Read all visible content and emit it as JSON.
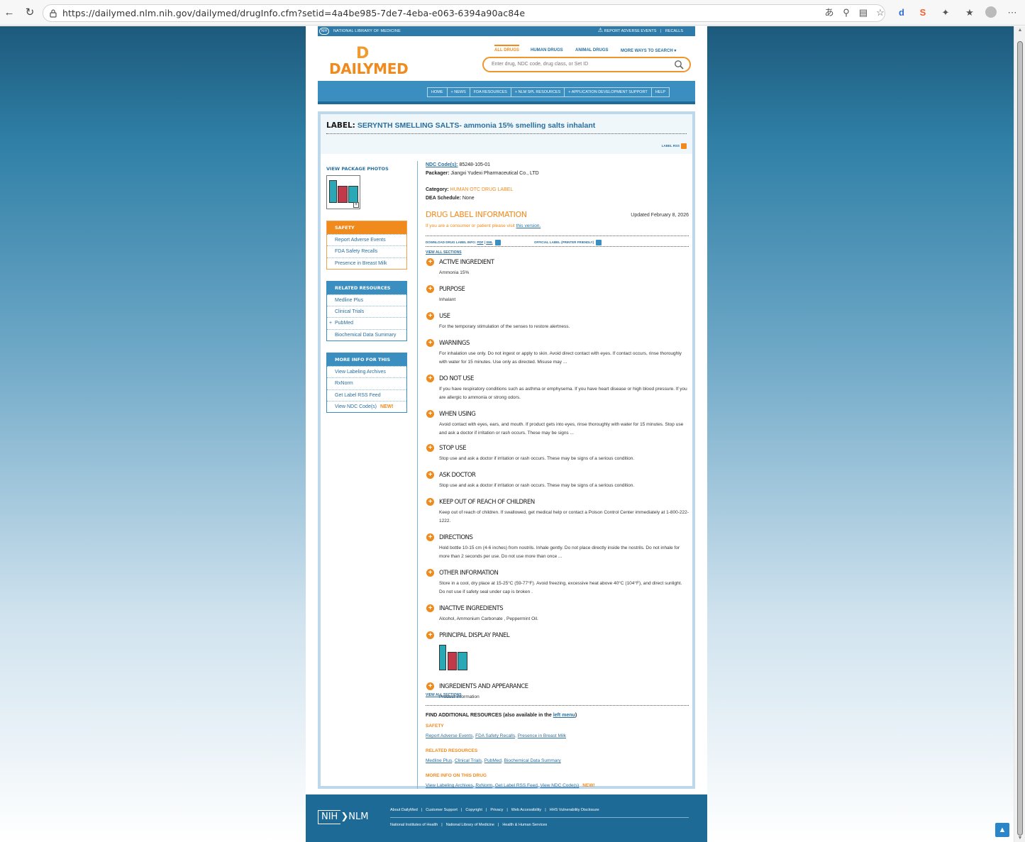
{
  "browser": {
    "url": "https://dailymed.nlm.nih.gov/dailymed/drugInfo.cfm?setid=4a4be985-7de7-4eba-e063-6394a90ac84e"
  },
  "nlm_bar": {
    "label": "NATIONAL LIBRARY OF MEDICINE",
    "nih": "NIH",
    "report": "REPORT ADVERSE EVENTS",
    "recalls": "RECALLS"
  },
  "logo": {
    "mark": "D",
    "word": "DAILYMED"
  },
  "top_tabs": [
    "ALL DRUGS",
    "HUMAN DRUGS",
    "ANIMAL DRUGS",
    "MORE WAYS TO SEARCH ▾"
  ],
  "search": {
    "placeholder": "Enter drug, NDC code, drug class, or Set ID"
  },
  "main_nav": [
    "HOME",
    "+ NEWS",
    "FDA RESOURCES",
    "+ NLM SPL RESOURCES",
    "+ APPLICATION DEVELOPMENT SUPPORT",
    "HELP"
  ],
  "label": {
    "prefix": "LABEL:",
    "name": "SERYNTH SMELLING SALTS- ammonia 15% smelling salts inhalant",
    "rss": "LABEL RSS"
  },
  "sidebar": {
    "view_package_photos": "VIEW PACKAGE PHOTOS",
    "safety": {
      "title": "SAFETY",
      "items": [
        "Report Adverse Events",
        "FDA Safety Recalls",
        "Presence in Breast Milk"
      ]
    },
    "related": {
      "title": "RELATED RESOURCES",
      "items": [
        "Medline Plus",
        "Clinical Trials",
        "PubMed",
        "Biochemical Data Summary"
      ]
    },
    "more": {
      "title": "MORE INFO FOR THIS DRUG",
      "items": [
        "View Labeling Archives",
        "RxNorm",
        "Get Label RSS Feed",
        "View NDC Code(s)"
      ],
      "new_tag": "NEW!"
    }
  },
  "meta": {
    "ndc_label": "NDC Code(s):",
    "ndc_value": "85248-105-01",
    "packager_label": "Packager:",
    "packager_value": "Jiangxi Yudexi Pharmaceutical Co., LTD",
    "category_label": "Category:",
    "category_value": "HUMAN OTC DRUG LABEL",
    "dea_label": "DEA Schedule:",
    "dea_value": "None"
  },
  "drug_label_info": {
    "title": "DRUG LABEL INFORMATION",
    "updated": "Updated February 8, 2026",
    "consumer_text": "If you are a consumer or patient please visit",
    "consumer_link": "this version.",
    "download_label": "DOWNLOAD DRUG LABEL INFO:",
    "pdf": "PDF",
    "xml": "XML",
    "official": "OFFICIAL LABEL (PRINTER FRIENDLY)",
    "view_all": "VIEW ALL SECTIONS"
  },
  "sections": [
    {
      "title": "ACTIVE INGREDIENT",
      "text": "Ammonia 15%"
    },
    {
      "title": "PURPOSE",
      "text": "Inhalant"
    },
    {
      "title": "USE",
      "text": "For the temporary stimulation of the senses to restore alertness."
    },
    {
      "title": "WARNINGS",
      "text": "For inhalation use only. Do not ingest or apply to skin. Avoid direct contact with eyes. If contact occurs, rinse thoroughly with water for 15 minutes. Use only as directed. Misuse may ..."
    },
    {
      "title": "DO NOT USE",
      "text": "If you have respiratory conditions such as asthma or emphysema. If you have heart disease or high blood pressure. If you are allergic to ammonia or strong odors."
    },
    {
      "title": "WHEN USING",
      "text": "Avoid contact with eyes, ears, and mouth. If product gets into eyes, rinse thoroughly with water for 15 minutes. Stop use and ask a doctor if irritation or rash occurs. These may be signs ..."
    },
    {
      "title": "STOP USE",
      "text": "Stop use and ask a doctor if irritation or rash occurs. These may be signs of a serious condition."
    },
    {
      "title": "ASK DOCTOR",
      "text": "Stop use and ask a doctor if irritation or rash occurs. These may be signs of a serious condition."
    },
    {
      "title": "KEEP OUT OF REACH OF CHILDREN",
      "text": "Keep out of reach of children. If swallowed, get medical help or contact a Poison Control Center immediately at 1-800-222-1222."
    },
    {
      "title": "DIRECTIONS",
      "text": "Hold bottle 10-15 cm (4-6 inches) from nostrils. Inhale gently. Do not place directly inside the nostrils. Do not inhale for more than 2 seconds per use. Do not use more than once ..."
    },
    {
      "title": "OTHER INFORMATION",
      "text": "Store in a cool, dry place at 15-25°C (59-77°F). Avoid freezing, excessive heat above 40°C (104°F), and direct sunlight. Do not use if safety seal under cap is broken ."
    },
    {
      "title": "INACTIVE INGREDIENTS",
      "text": "Alcohol, Ammonium Carbonate , Peppermint Oil."
    },
    {
      "title": "PRINCIPAL DISPLAY PANEL",
      "text": ""
    },
    {
      "title": "INGREDIENTS AND APPEARANCE",
      "text": "Product Information"
    }
  ],
  "find_more": {
    "title_prefix": "FIND ADDITIONAL RESOURCES (also available in the",
    "title_link": "left menu",
    "title_suffix": ")",
    "safety_head": "SAFETY",
    "safety_links": [
      "Report Adverse Events",
      "FDA Safety Recalls",
      "Presence in Breast Milk"
    ],
    "related_head": "RELATED RESOURCES",
    "related_links": [
      "Medline Plus",
      "Clinical Trials",
      "PubMed",
      "Biochemical Data Summary"
    ],
    "more_head": "MORE INFO ON THIS DRUG",
    "more_links": [
      "View Labeling Archives",
      "RxNorm",
      "Get Label RSS Feed",
      "View NDC Code(s)"
    ],
    "new_tag": "NEW!"
  },
  "footer": {
    "nih": "NIH",
    "nlm": "NLM",
    "links1": [
      "About DailyMed",
      "Customer Support",
      "Copyright",
      "Privacy",
      "Web Accessibility",
      "HHS Vulnerability Disclosure"
    ],
    "links2": [
      "National Institutes of Health",
      "National Library of Medicine",
      "Health & Human Services"
    ]
  },
  "colors": {
    "brand_orange": "#f08a1c",
    "brand_blue": "#2a6f9e",
    "nav_blue": "#3a8ec0"
  }
}
